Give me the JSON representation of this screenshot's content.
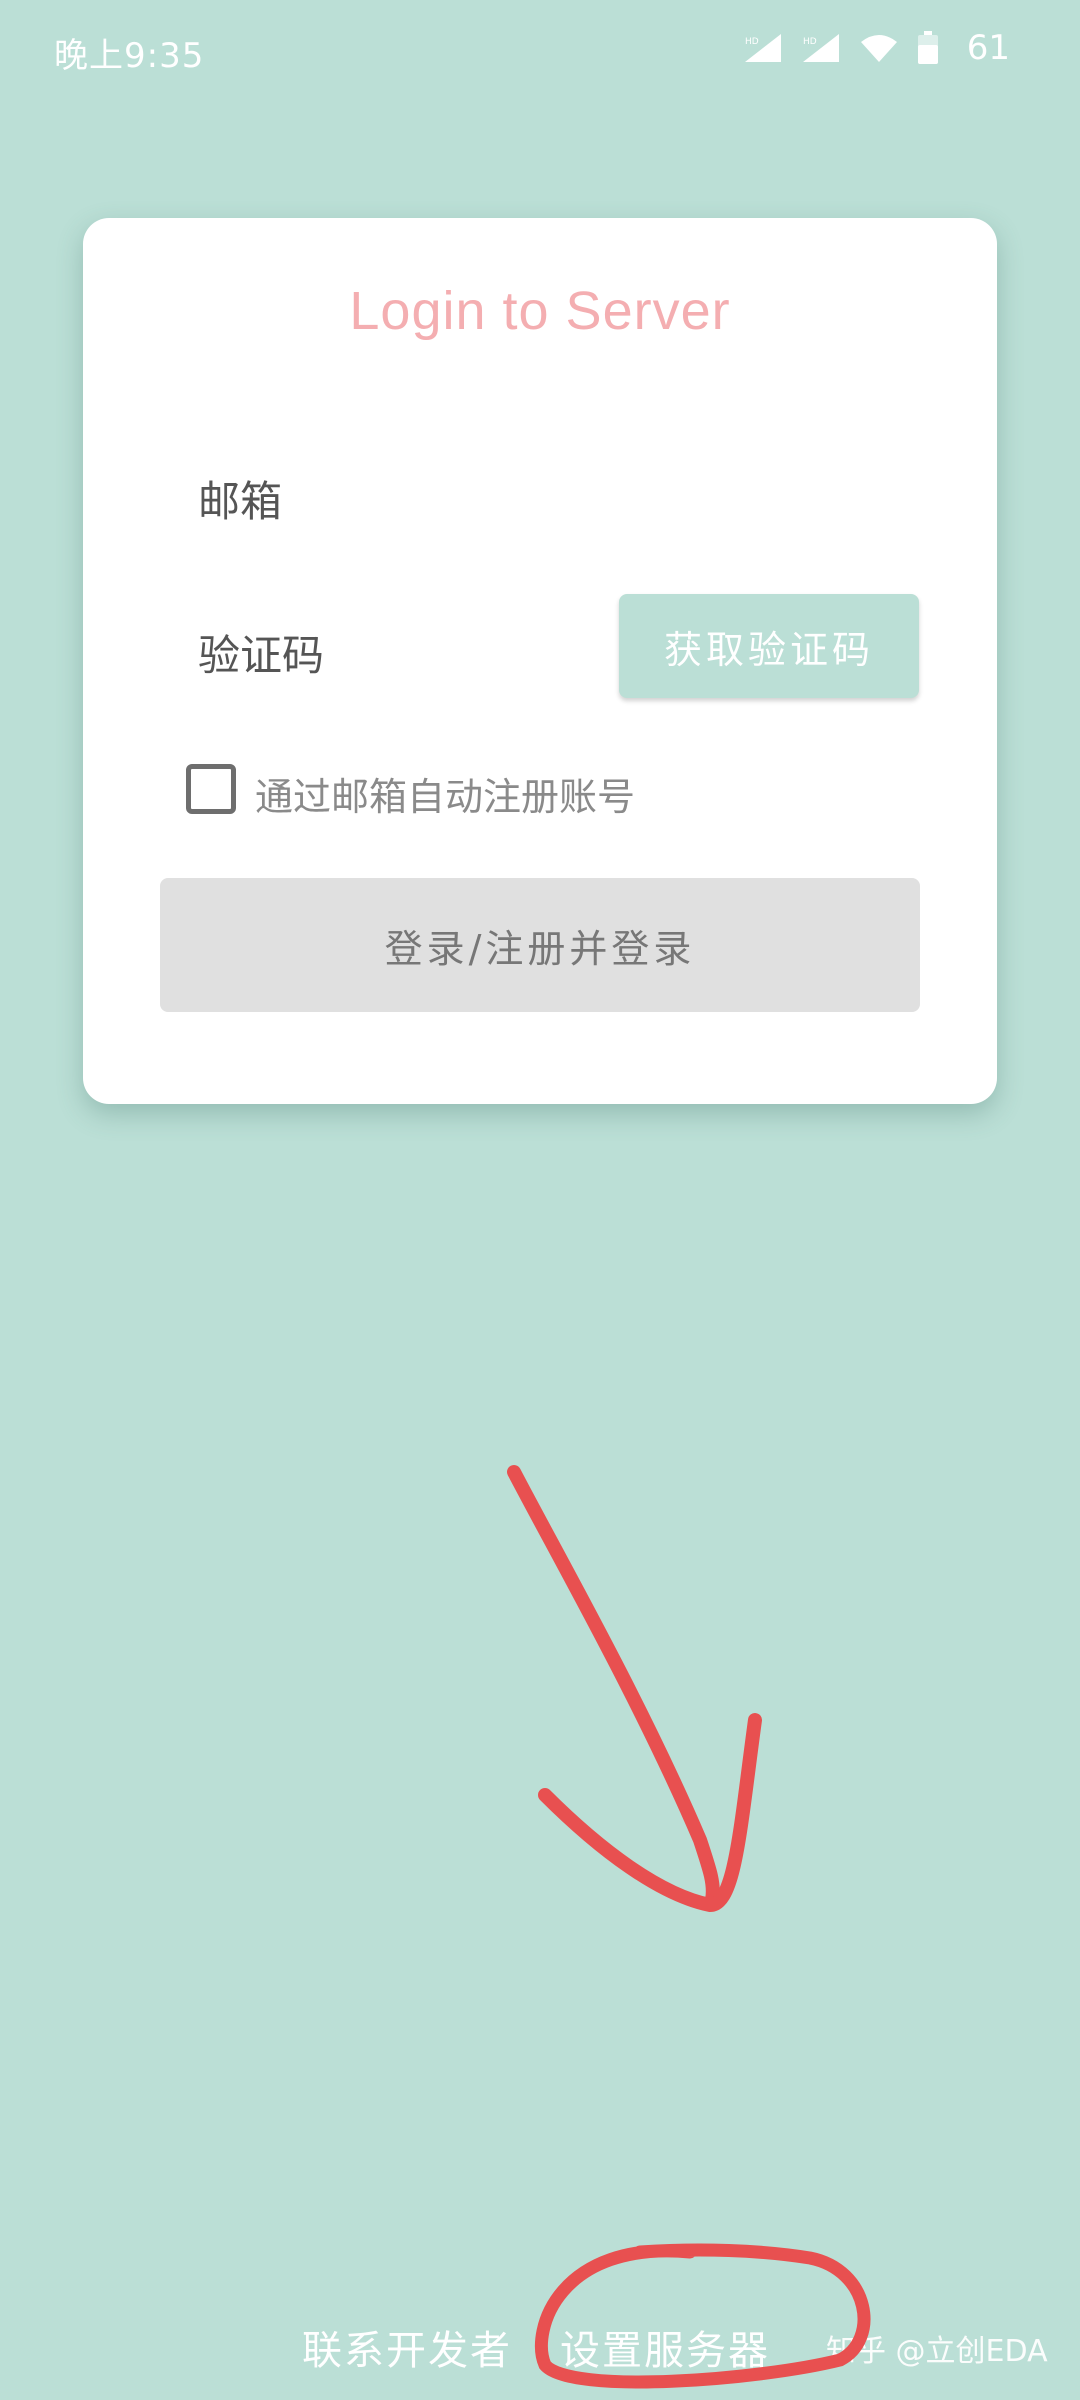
{
  "status_bar": {
    "time": "晚上9:35",
    "battery": "61",
    "icons": [
      "hd-signal-icon",
      "hd-signal-icon",
      "wifi-icon",
      "battery-icon"
    ]
  },
  "card": {
    "title": "Login to Server",
    "email_label": "邮箱",
    "email_value": "",
    "code_label": "验证码",
    "code_value": "",
    "get_code_label": "获取验证码",
    "auto_register_label": "通过邮箱自动注册账号",
    "auto_register_checked": false,
    "login_label": "登录/注册并登录"
  },
  "footer": {
    "contact_label": "联系开发者",
    "server_label": "设置服务器"
  },
  "watermark": "知乎 @立创EDA",
  "colors": {
    "background": "#bbdfd6",
    "title": "#f4aeb1",
    "annotation": "#e85050"
  }
}
